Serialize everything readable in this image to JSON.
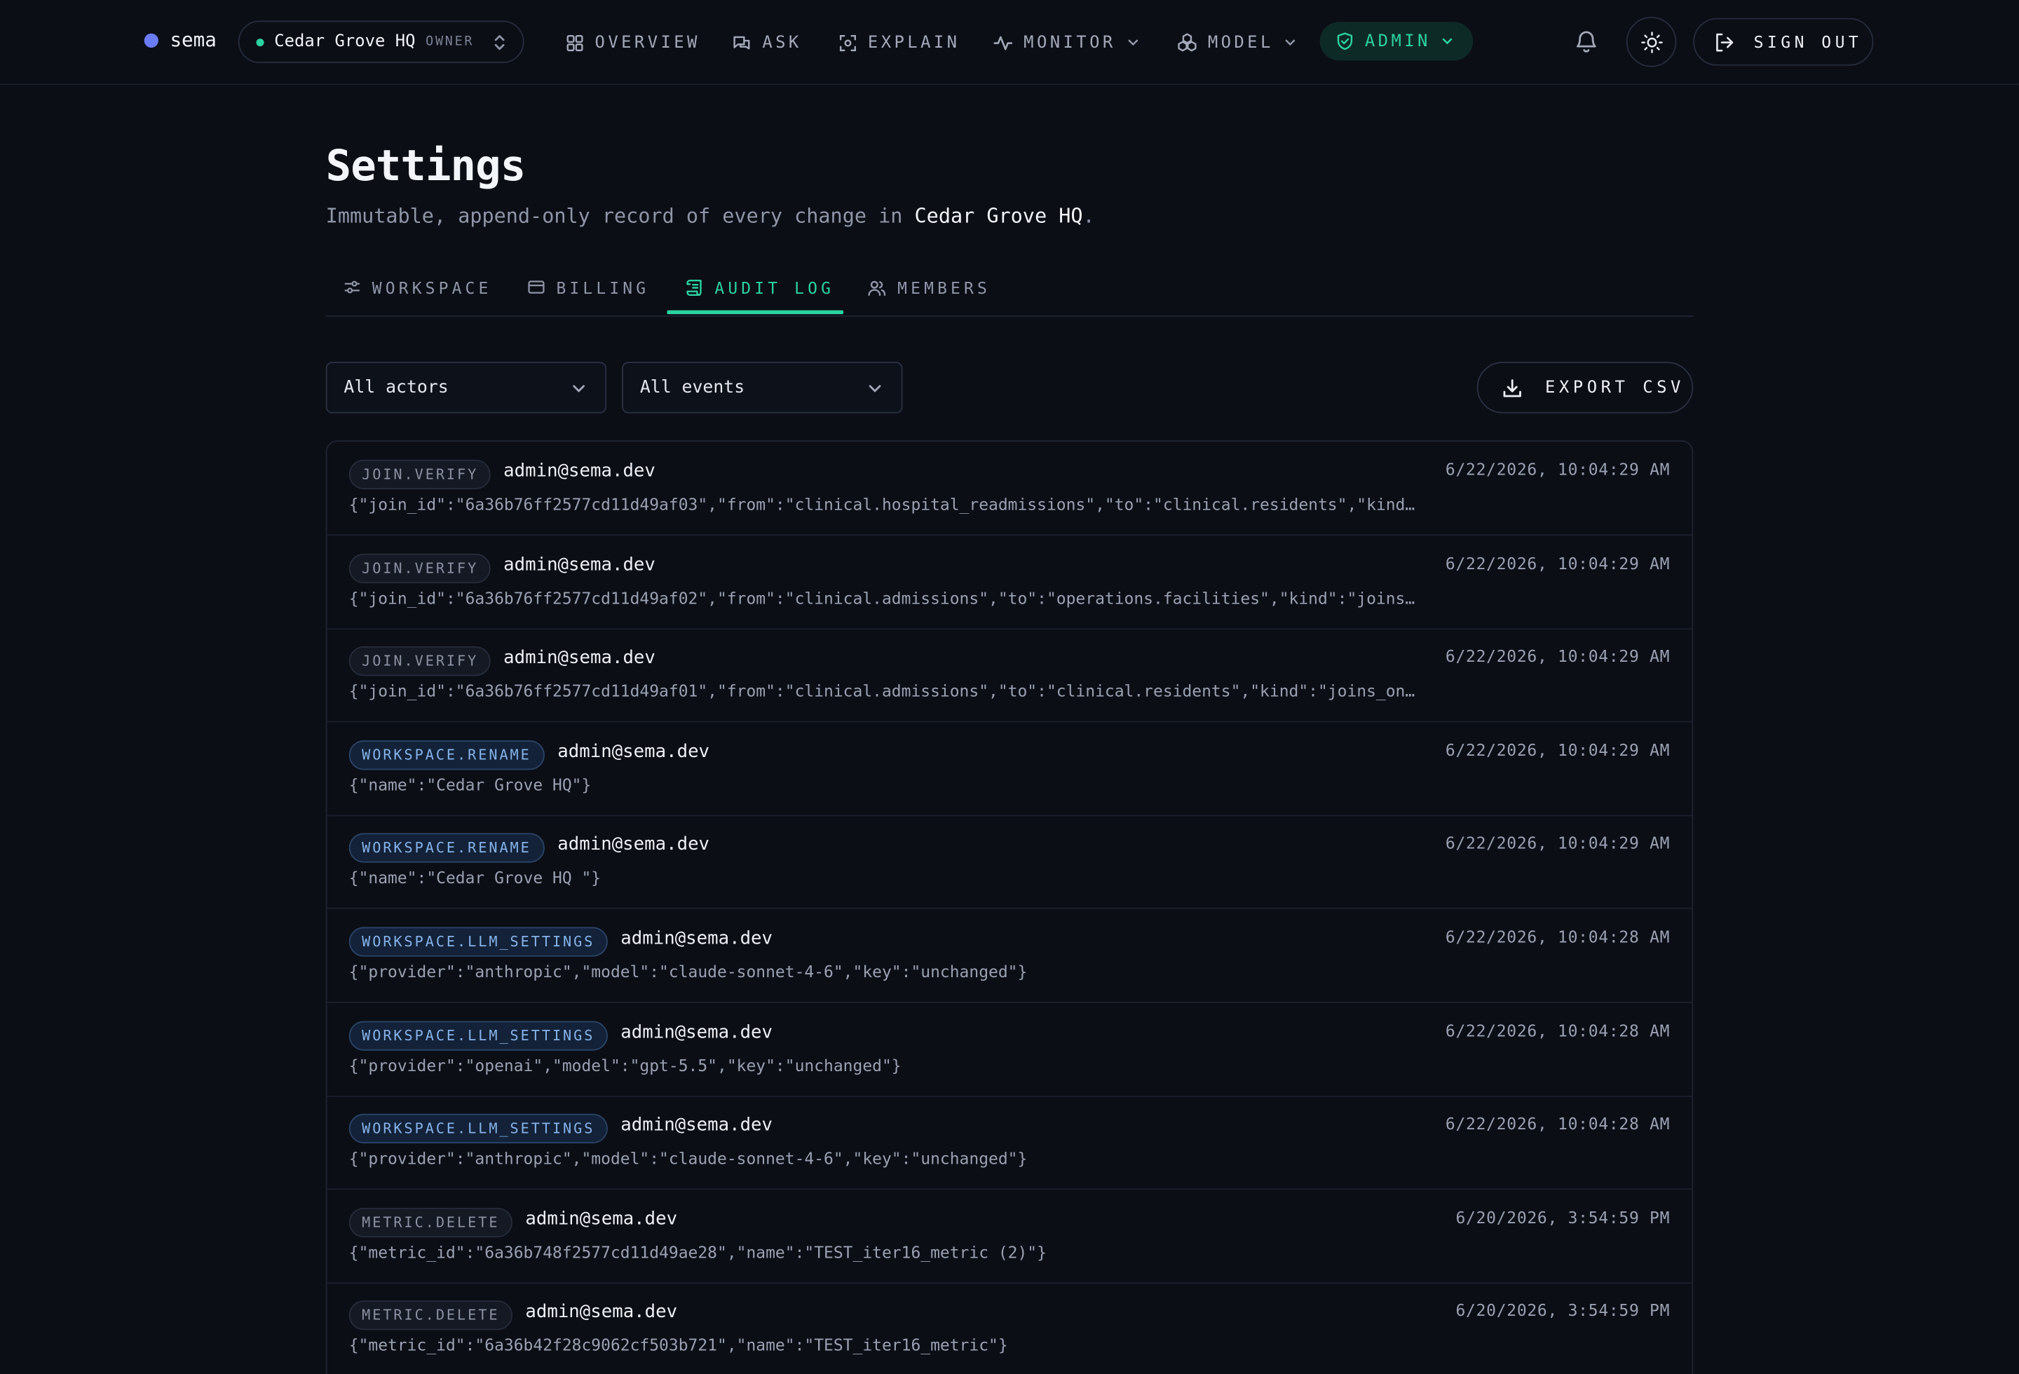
{
  "brand": {
    "name": "sema",
    "color": "#6a7cf5"
  },
  "workspace": {
    "name": "Cedar Grove HQ",
    "role": "OWNER"
  },
  "nav": {
    "overview": "OVERVIEW",
    "ask": "ASK",
    "explain": "EXPLAIN",
    "monitor": "MONITOR",
    "model": "MODEL",
    "admin": "ADMIN",
    "sign_out": "SIGN OUT"
  },
  "page": {
    "title": "Settings",
    "subtitle_prefix": "Immutable, append-only record of every change in ",
    "subtitle_workspace": "Cedar Grove HQ",
    "subtitle_suffix": "."
  },
  "tabs": {
    "workspace": "WORKSPACE",
    "billing": "BILLING",
    "audit_log": "AUDIT LOG",
    "members": "MEMBERS",
    "active": "AUDIT LOG"
  },
  "filters": {
    "actors": "All actors",
    "events": "All events",
    "export": "EXPORT CSV"
  },
  "colors": {
    "accent": "#2cd3a0",
    "background": "#0b0e15",
    "badge_blue": "#86b3ea",
    "badge_gray": "#8b92a3"
  },
  "log": [
    {
      "event": "JOIN.VERIFY",
      "style": "gray",
      "actor": "admin@sema.dev",
      "timestamp": "6/22/2026, 10:04:29 AM",
      "payload": "{\"join_id\":\"6a36b76ff2577cd11d49af03\",\"from\":\"clinical.hospital_readmissions\",\"to\":\"clinical.residents\",\"kind…"
    },
    {
      "event": "JOIN.VERIFY",
      "style": "gray",
      "actor": "admin@sema.dev",
      "timestamp": "6/22/2026, 10:04:29 AM",
      "payload": "{\"join_id\":\"6a36b76ff2577cd11d49af02\",\"from\":\"clinical.admissions\",\"to\":\"operations.facilities\",\"kind\":\"joins…"
    },
    {
      "event": "JOIN.VERIFY",
      "style": "gray",
      "actor": "admin@sema.dev",
      "timestamp": "6/22/2026, 10:04:29 AM",
      "payload": "{\"join_id\":\"6a36b76ff2577cd11d49af01\",\"from\":\"clinical.admissions\",\"to\":\"clinical.residents\",\"kind\":\"joins_on…"
    },
    {
      "event": "WORKSPACE.RENAME",
      "style": "blue",
      "actor": "admin@sema.dev",
      "timestamp": "6/22/2026, 10:04:29 AM",
      "payload": "{\"name\":\"Cedar Grove HQ\"}"
    },
    {
      "event": "WORKSPACE.RENAME",
      "style": "blue",
      "actor": "admin@sema.dev",
      "timestamp": "6/22/2026, 10:04:29 AM",
      "payload": "{\"name\":\"Cedar Grove HQ \"}"
    },
    {
      "event": "WORKSPACE.LLM_SETTINGS",
      "style": "blue",
      "actor": "admin@sema.dev",
      "timestamp": "6/22/2026, 10:04:28 AM",
      "payload": "{\"provider\":\"anthropic\",\"model\":\"claude-sonnet-4-6\",\"key\":\"unchanged\"}"
    },
    {
      "event": "WORKSPACE.LLM_SETTINGS",
      "style": "blue",
      "actor": "admin@sema.dev",
      "timestamp": "6/22/2026, 10:04:28 AM",
      "payload": "{\"provider\":\"openai\",\"model\":\"gpt-5.5\",\"key\":\"unchanged\"}"
    },
    {
      "event": "WORKSPACE.LLM_SETTINGS",
      "style": "blue",
      "actor": "admin@sema.dev",
      "timestamp": "6/22/2026, 10:04:28 AM",
      "payload": "{\"provider\":\"anthropic\",\"model\":\"claude-sonnet-4-6\",\"key\":\"unchanged\"}"
    },
    {
      "event": "METRIC.DELETE",
      "style": "gray",
      "actor": "admin@sema.dev",
      "timestamp": "6/20/2026, 3:54:59 PM",
      "payload": "{\"metric_id\":\"6a36b748f2577cd11d49ae28\",\"name\":\"TEST_iter16_metric (2)\"}"
    },
    {
      "event": "METRIC.DELETE",
      "style": "gray",
      "actor": "admin@sema.dev",
      "timestamp": "6/20/2026, 3:54:59 PM",
      "payload": "{\"metric_id\":\"6a36b42f28c9062cf503b721\",\"name\":\"TEST_iter16_metric\"}"
    }
  ]
}
